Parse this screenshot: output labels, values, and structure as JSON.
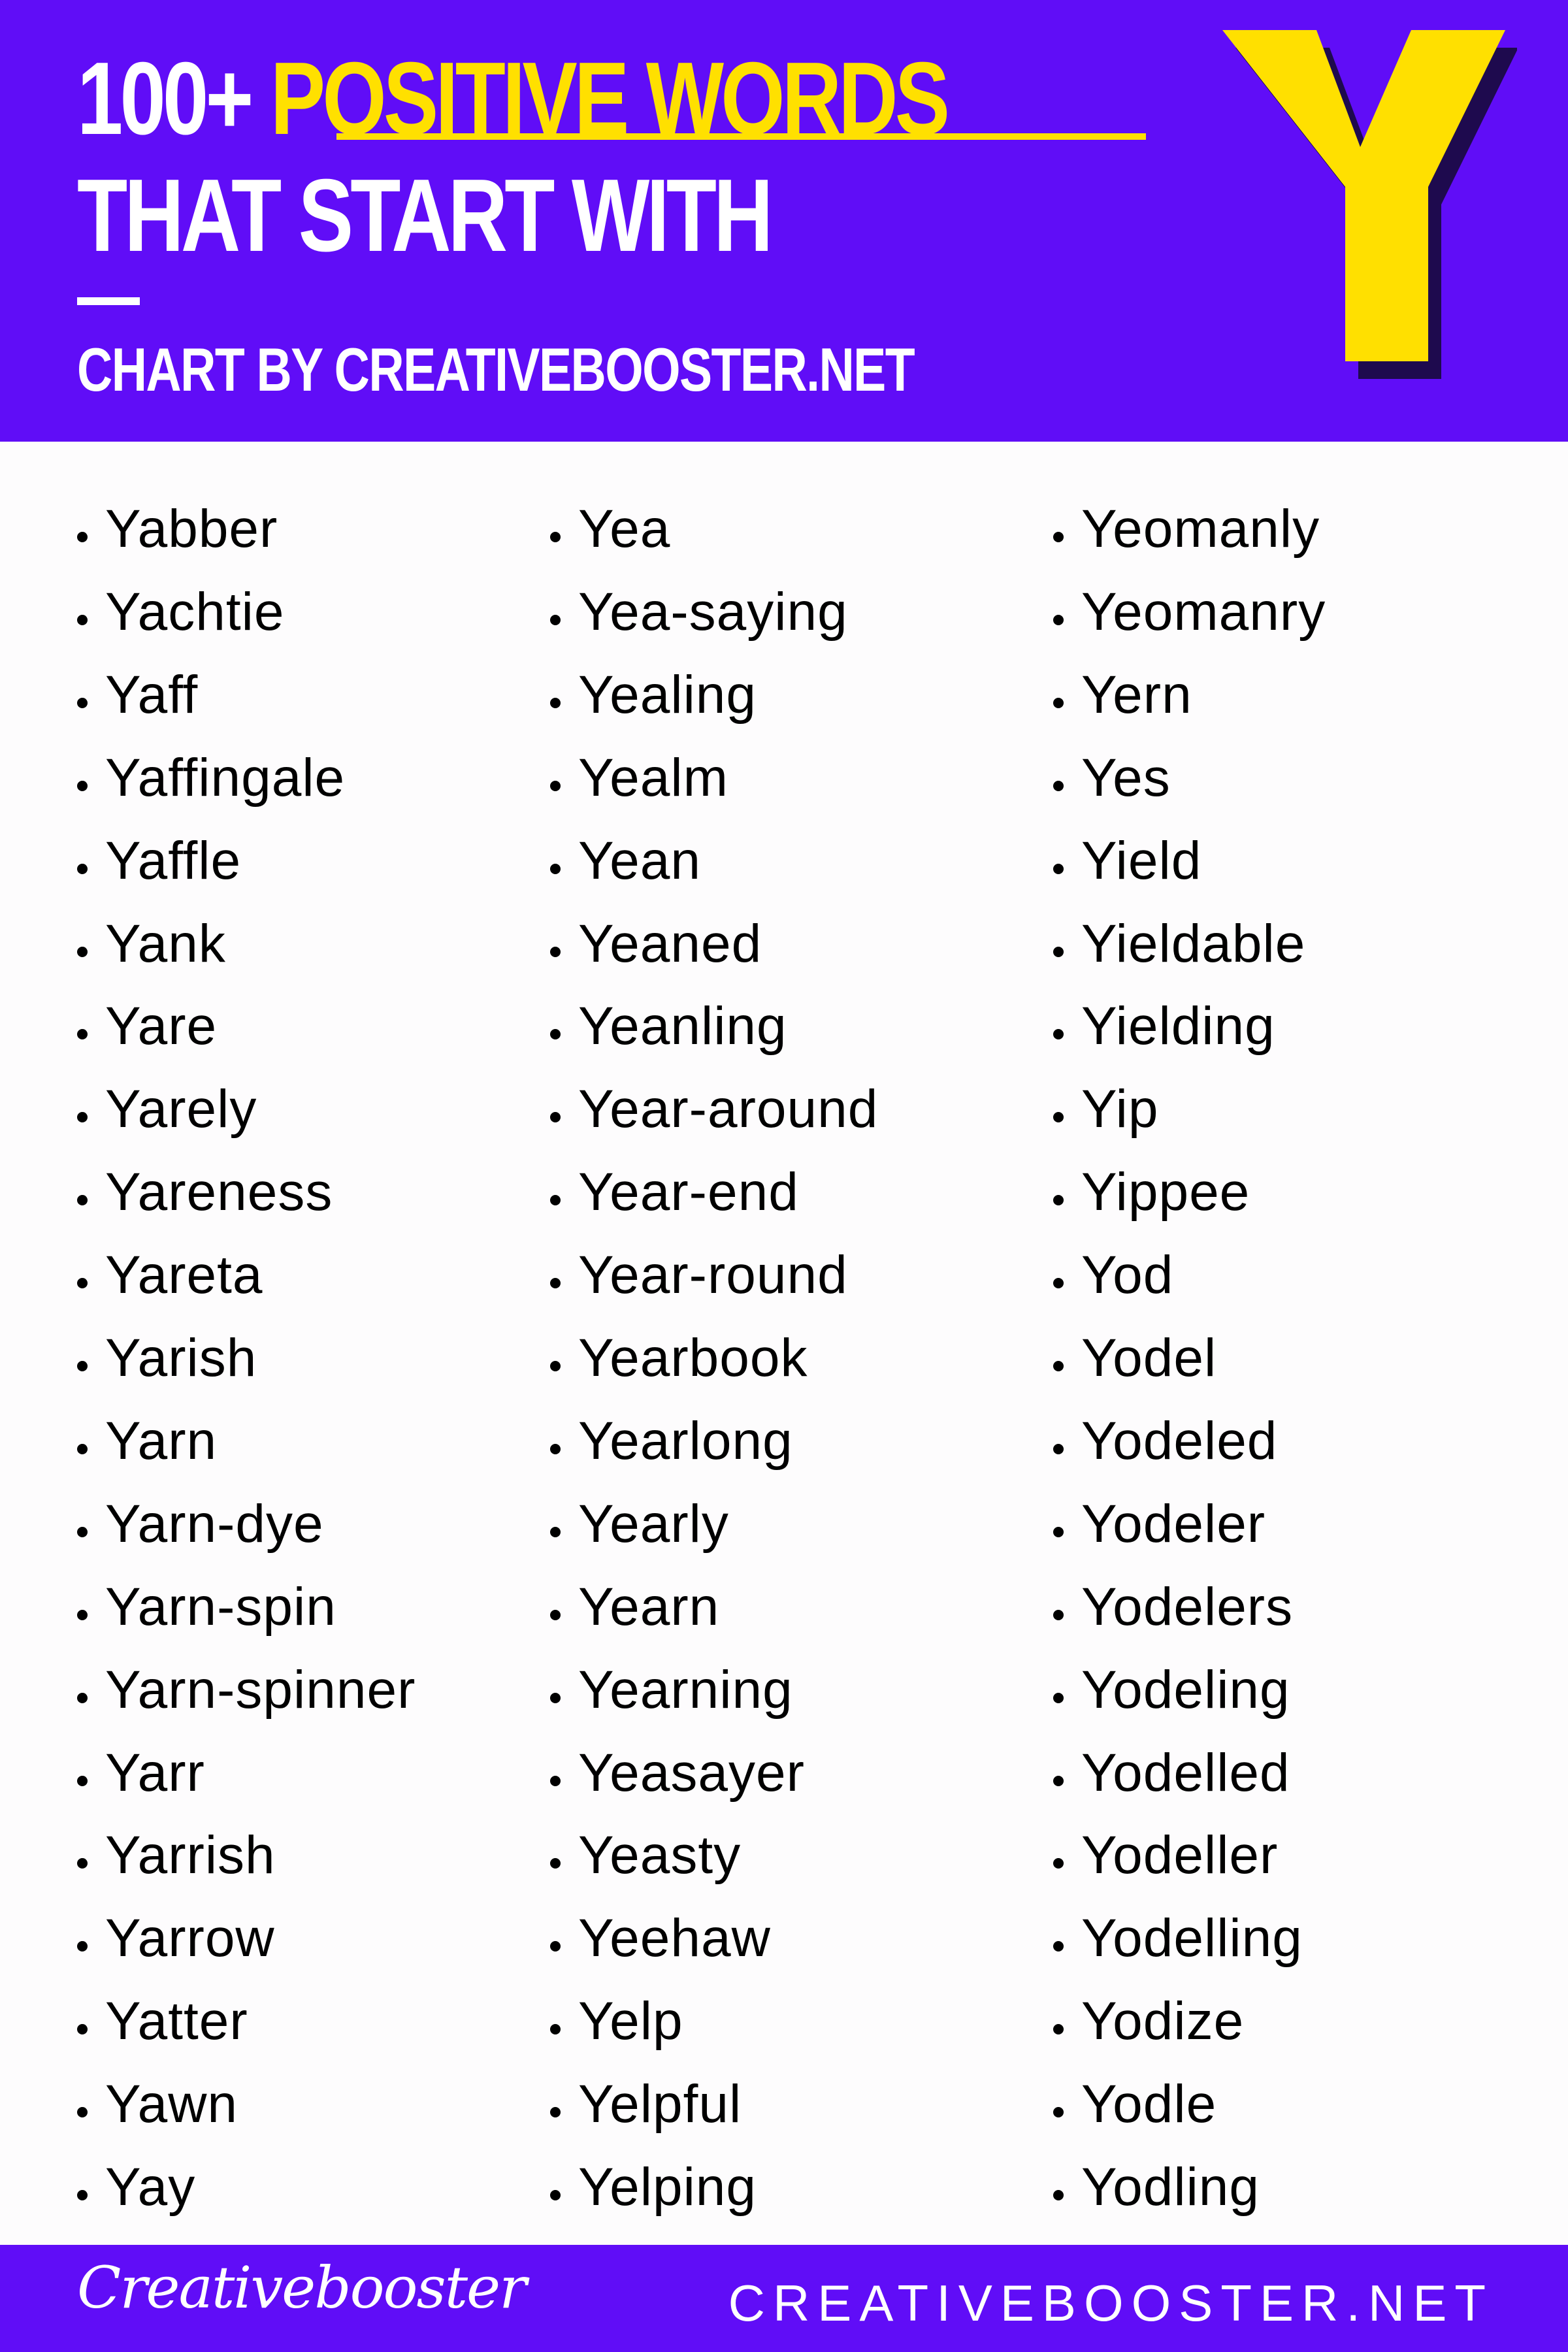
{
  "colors": {
    "brand_purple": "#600df7",
    "accent_yellow": "#ffe000",
    "letter_shadow": "#1e0a4e",
    "body_background": "#fdfcfd",
    "text": "#000000"
  },
  "header": {
    "count_label": "100+",
    "highlight": "POSITIVE WORDS",
    "title_line_2": "THAT START WITH",
    "credit": "CHART BY CREATIVEBOOSTER.NET",
    "letter": "Y"
  },
  "columns": [
    {
      "words": [
        "Yabber",
        "Yachtie",
        "Yaff",
        "Yaffingale",
        "Yaffle",
        "Yank",
        "Yare",
        "Yarely",
        "Yareness",
        "Yareta",
        "Yarish",
        "Yarn",
        "Yarn-dye",
        "Yarn-spin",
        "Yarn-spinner",
        "Yarr",
        "Yarrish",
        "Yarrow",
        "Yatter",
        "Yawn",
        "Yay"
      ]
    },
    {
      "words": [
        "Yea",
        "Yea-saying",
        "Yealing",
        "Yealm",
        "Yean",
        "Yeaned",
        "Yeanling",
        "Year-around",
        "Year-end",
        "Year-round",
        "Yearbook",
        "Yearlong",
        "Yearly",
        "Yearn",
        "Yearning",
        "Yeasayer",
        "Yeasty",
        "Yeehaw",
        "Yelp",
        "Yelpful",
        "Yelping"
      ]
    },
    {
      "words": [
        "Yeomanly",
        "Yeomanry",
        "Yern",
        "Yes",
        "Yield",
        "Yieldable",
        "Yielding",
        "Yip",
        "Yippee",
        "Yod",
        "Yodel",
        "Yodeled",
        "Yodeler",
        "Yodelers",
        "Yodeling",
        "Yodelled",
        "Yodeller",
        "Yodelling",
        "Yodize",
        "Yodle",
        "Yodling"
      ]
    }
  ],
  "footer": {
    "logo_text": "Creativebooster",
    "url": "CREATIVEBOOSTER.NET"
  }
}
